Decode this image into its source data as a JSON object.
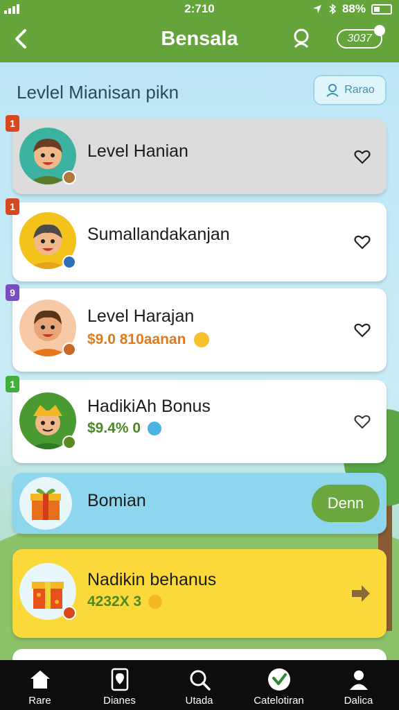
{
  "status_bar": {
    "time": "2:710",
    "battery": "88%"
  },
  "app_bar": {
    "title": "Bensala",
    "coins": "3037"
  },
  "section": {
    "header": "Levlel Mianisan pikn",
    "friends_button": "Rarao"
  },
  "cards": [
    {
      "badge": "1",
      "badge_color": "#d8481e",
      "title": "Level Hanian",
      "subtitle": ""
    },
    {
      "badge": "1",
      "badge_color": "#d8481e",
      "title": "Sumallandakanjan",
      "subtitle": ""
    },
    {
      "badge": "9",
      "badge_color": "#7a4cc2",
      "title": "Level Harajan",
      "subtitle": "$9.0 810aanan"
    },
    {
      "badge": "1",
      "badge_color": "#3fae3a",
      "title": "HadikiAh Bonus",
      "subtitle": "$9.4% 0"
    },
    {
      "title": "Bomian",
      "button": "Denn"
    },
    {
      "title": "Nadikin behanus",
      "subtitle": "4232X 3"
    }
  ],
  "bottom_nav": [
    {
      "label": "Rare",
      "icon": "home-icon"
    },
    {
      "label": "Dianes",
      "icon": "map-pin-icon"
    },
    {
      "label": "Utada",
      "icon": "search-icon"
    },
    {
      "label": "Catelotiran",
      "icon": "check-circle-icon"
    },
    {
      "label": "Dalica",
      "icon": "person-icon"
    }
  ],
  "colors": {
    "primary_green": "#64a43a",
    "orange_text": "#e07a1c",
    "green_text": "#4a8a24",
    "yellow_card": "#fbd93a",
    "blue_card": "#8ed5ee"
  }
}
